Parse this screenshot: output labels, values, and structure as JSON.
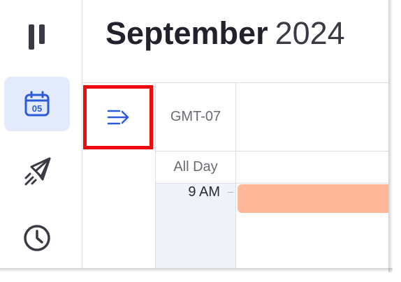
{
  "header": {
    "month": "September",
    "year": "2024"
  },
  "grid": {
    "timezone": "GMT-07",
    "all_day_label": "All Day",
    "time_labels": [
      "9 AM"
    ]
  },
  "sidebar": {
    "items": [
      {
        "icon": "pause-icon"
      },
      {
        "icon": "calendar-icon",
        "badge": "05",
        "active": true
      },
      {
        "icon": "rocket-icon"
      },
      {
        "icon": "clock-icon"
      }
    ]
  },
  "colors": {
    "accent": "#2b5bd7",
    "active_bg": "#e3ebfb",
    "event": "#ffb899",
    "highlight": "#ee0a0a"
  }
}
